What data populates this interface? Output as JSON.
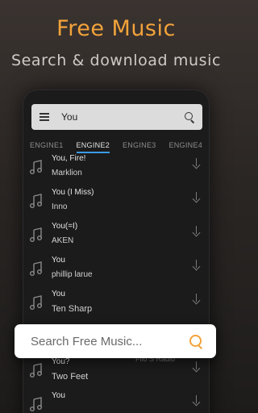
{
  "promo": {
    "headline": "Free Music",
    "subline": "Search & download music"
  },
  "search": {
    "query": "You"
  },
  "tabs": [
    {
      "label": "ENGINE1",
      "active": false
    },
    {
      "label": "ENGINE2",
      "active": true
    },
    {
      "label": "ENGINE3",
      "active": false
    },
    {
      "label": "ENGINE4",
      "active": false
    }
  ],
  "songs": [
    {
      "title": "You, Fire!",
      "artist": "Marklion"
    },
    {
      "title": "You (I Miss)",
      "artist": "Inno"
    },
    {
      "title": "You(=I)",
      "artist": "AKEN"
    },
    {
      "title": "You",
      "artist": "phillip larue"
    },
    {
      "title": "You",
      "artist": "Ten Sharp"
    },
    {
      "title": "",
      "artist": ""
    },
    {
      "title": "You?",
      "artist": "Two Feet"
    },
    {
      "title": "You",
      "artist": ""
    }
  ],
  "partially_hidden_label": "Filo S Radio",
  "overlay": {
    "placeholder": "Search Free Music..."
  },
  "colors": {
    "accent": "#f2a33a",
    "tab_underline": "#3b9be5"
  },
  "icons": {
    "menu": "hamburger-menu-icon",
    "search": "search-icon",
    "song": "music-note-icon",
    "download": "download-arrow-icon"
  }
}
